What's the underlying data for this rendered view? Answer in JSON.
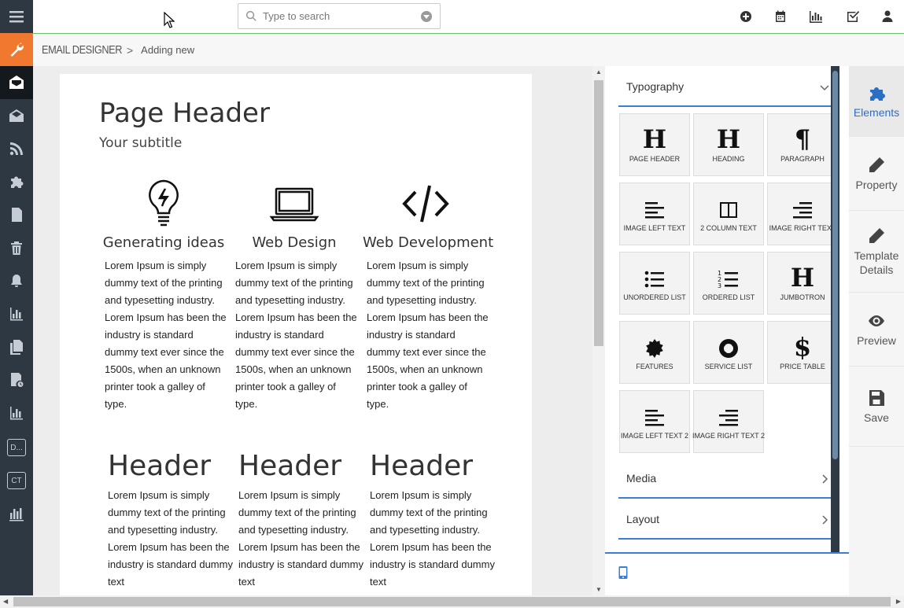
{
  "search": {
    "placeholder": "Type to search"
  },
  "breadcrumb": {
    "root": "EMAIL DESIGNER",
    "separator": ">",
    "current": "Adding new"
  },
  "left_sidebar": {
    "items": [
      {
        "icon": "hamburger-menu-icon"
      },
      {
        "icon": "wrench-icon",
        "color": "#f0792f"
      },
      {
        "icon": "open-envelope-icon",
        "color": "#14191e"
      },
      {
        "icon": "envelope-icon"
      },
      {
        "icon": "rss-icon"
      },
      {
        "icon": "puzzle-icon"
      },
      {
        "icon": "document-icon"
      },
      {
        "icon": "trash-icon"
      },
      {
        "icon": "bell-icon"
      },
      {
        "icon": "bar-chart-icon"
      },
      {
        "icon": "copy-icon"
      },
      {
        "icon": "invoice-icon"
      },
      {
        "icon": "bar-chart-icon"
      },
      {
        "icon": "text-box",
        "label": "D..."
      },
      {
        "icon": "text-box",
        "label": "CT"
      },
      {
        "icon": "bar-chart-icon"
      }
    ]
  },
  "topbar_icons": [
    "plus-circle-icon",
    "calendar-icon",
    "bar-chart-icon",
    "checkbox-icon",
    "user-icon"
  ],
  "email": {
    "page_header": "Page Header",
    "subtitle": "Your subtitle",
    "features": [
      {
        "icon": "lightbulb-icon",
        "title": "Generating ideas",
        "text": "Lorem Ipsum is simply dummy text of the printing and typesetting industry. Lorem Ipsum has been the industry is standard dummy text ever since the 1500s, when an unknown printer took a galley of type."
      },
      {
        "icon": "laptop-icon",
        "title": "Web Design",
        "text": "Lorem Ipsum is simply dummy text of the printing and typesetting industry. Lorem Ipsum has been the industry is standard dummy text ever since the 1500s, when an unknown printer took a galley of type."
      },
      {
        "icon": "code-icon",
        "title": "Web Development",
        "text": "Lorem Ipsum is simply dummy text of the printing and typesetting industry. Lorem Ipsum has been the industry is standard dummy text ever since the 1500s, when an unknown printer took a galley of type."
      }
    ],
    "columns": [
      {
        "title": "Header",
        "text": "Lorem Ipsum is simply dummy text of the printing and typesetting industry. Lorem Ipsum has been the industry is standard dummy text"
      },
      {
        "title": "Header",
        "text": "Lorem Ipsum is simply dummy text of the printing and typesetting industry. Lorem Ipsum has been the industry is standard dummy text"
      },
      {
        "title": "Header",
        "text": "Lorem Ipsum is simply dummy text of the printing and typesetting industry. Lorem Ipsum has been the industry is standard dummy text"
      }
    ]
  },
  "panel": {
    "sections": {
      "typography": "Typography",
      "media": "Media",
      "layout": "Layout"
    },
    "tiles": [
      {
        "icon": "heading-h-icon",
        "glyph": "H",
        "label": "PAGE HEADER"
      },
      {
        "icon": "heading-h-icon",
        "glyph": "H",
        "label": "HEADING"
      },
      {
        "icon": "paragraph-icon",
        "glyph": "¶",
        "label": "PARAGRAPH"
      },
      {
        "icon": "align-left-icon",
        "label": "IMAGE LEFT TEXT"
      },
      {
        "icon": "columns-icon",
        "label": "2 COLUMN TEXT"
      },
      {
        "icon": "align-right-icon",
        "label": "IMAGE RIGHT TEXT"
      },
      {
        "icon": "unordered-list-icon",
        "label": "UNORDERED LIST"
      },
      {
        "icon": "ordered-list-icon",
        "label": "ORDERED LIST"
      },
      {
        "icon": "heading-h-icon",
        "glyph": "H",
        "label": "JUMBOTRON"
      },
      {
        "icon": "certificate-icon",
        "label": "FEATURES"
      },
      {
        "icon": "life-ring-icon",
        "label": "SERVICE LIST"
      },
      {
        "icon": "dollar-icon",
        "glyph": "$",
        "label": "PRICE TABLE"
      },
      {
        "icon": "align-left-icon",
        "label": "IMAGE LEFT TEXT 2"
      },
      {
        "icon": "align-right-icon",
        "label": "IMAGE RIGHT TEXT 2"
      }
    ]
  },
  "tools": {
    "elements": "Elements",
    "property": "Property",
    "template_details": "Template Details",
    "preview": "Preview",
    "save": "Save"
  },
  "colors": {
    "accent": "#3b7dd8",
    "sidebar": "#2e3842",
    "active_tool": "#2a6ec6",
    "highlight": "#f0792f"
  }
}
